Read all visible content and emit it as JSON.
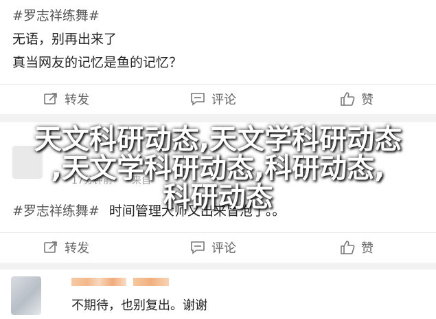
{
  "post1": {
    "tag": "#罗志祥练舞#",
    "line1": "无语，别再出来了",
    "line2": "真当网友的记忆是鱼的记忆？"
  },
  "actions": {
    "repost": "转发",
    "comment": "评论",
    "like": "赞"
  },
  "overlay": {
    "line1": "天文科研动态,天文学科研动态",
    "line2": ",天文学科研动态,科研动态,",
    "line3": "科研动态"
  },
  "post2": {
    "meta_time": "17分钟前",
    "meta_source": "来自",
    "tag": "#罗志祥练舞#",
    "text": "时间管理大师又出来冒泡了。。"
  },
  "post3": {
    "text": "不期待，也别复出。谢谢"
  },
  "colors": {
    "divider": "#e6e6e6",
    "action_text": "#666666",
    "tag_text": "#555555"
  }
}
